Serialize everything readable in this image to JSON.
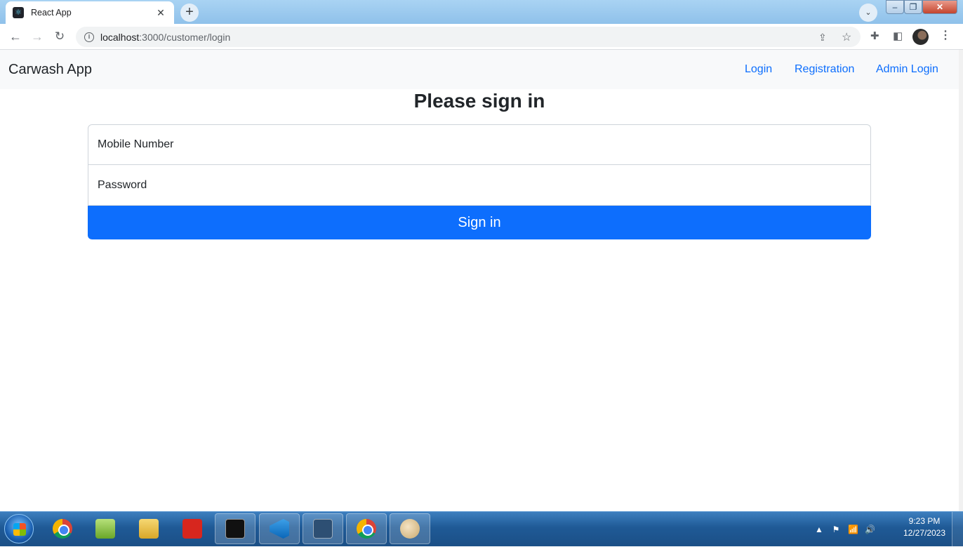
{
  "browser": {
    "tab_title": "React App",
    "tab_close": "✕",
    "new_tab": "+",
    "tab_search": "⌄",
    "url_host": "localhost",
    "url_rest": ":3000/customer/login",
    "nav": {
      "back": "←",
      "forward": "→",
      "reload": "↻"
    },
    "icons": {
      "share": "⇪",
      "star": "☆",
      "extensions": "✚",
      "side_panel": "◧",
      "menu": "⋮"
    },
    "window": {
      "minimize": "–",
      "maximize": "❐",
      "close": "✕"
    }
  },
  "app": {
    "brand": "Carwash App",
    "nav_links": [
      "Login",
      "Registration",
      "Admin Login"
    ],
    "title": "Please sign in",
    "mobile_placeholder": "Mobile Number",
    "password_placeholder": "Password",
    "submit_label": "Sign in",
    "accent_color": "#0d6efd"
  },
  "taskbar": {
    "apps": [
      "chrome",
      "notepad",
      "file-explorer",
      "acrobat",
      "cmd",
      "vscode",
      "mysql-workbench",
      "chrome",
      "paint"
    ],
    "active_app": "chrome",
    "clock_time": "9:23 PM",
    "clock_date": "12/27/2023",
    "tray": {
      "show_hidden": "▲",
      "flag": "⚑",
      "network": "📶",
      "volume": "🔊"
    }
  }
}
